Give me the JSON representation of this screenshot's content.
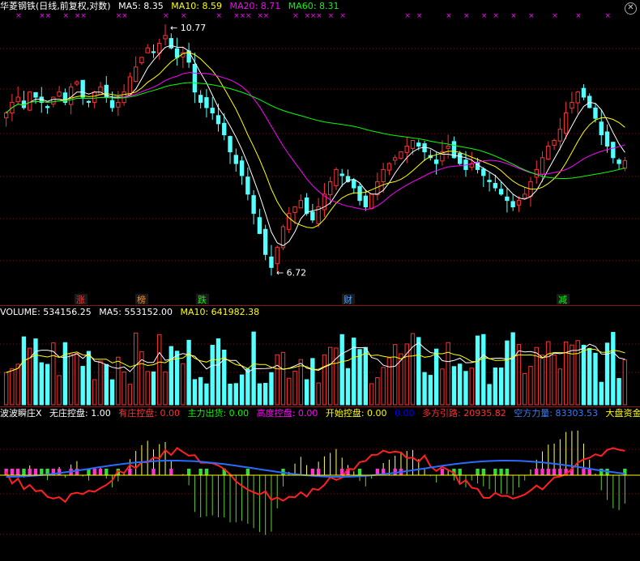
{
  "main": {
    "title": "华菱钢铁(日线,前复权,对数)",
    "ma5": "MA5: 8.35",
    "ma10": "MA10: 8.59",
    "ma20": "MA20: 8.71",
    "ma60": "MA60: 8.31",
    "high_label": "10.77",
    "low_label": "6.72",
    "event_markers": [
      "涨",
      "榜",
      "跌",
      "财",
      "减"
    ],
    "colors": {
      "up": "#ff3232",
      "down": "#54ffff",
      "ma5": "#ffffff",
      "ma10": "#ffff00",
      "ma20": "#ff00ff",
      "ma60": "#00ff00",
      "marker": "#ff00ff"
    }
  },
  "volume": {
    "volume": "VOLUME: 534156.25",
    "ma5": "MA5: 553152.00",
    "ma10": "MA10: 641982.38"
  },
  "indicator": {
    "name": "波波瞬庄X",
    "items": [
      {
        "text": "无庄控盘: 1.00",
        "color": "#ffffff"
      },
      {
        "text": "有庄控盘: 0.00",
        "color": "#ff3232"
      },
      {
        "text": "主力出货: 0.00",
        "color": "#00ff00"
      },
      {
        "text": "高度控盘: 0.00",
        "color": "#ff00ff"
      },
      {
        "text": "开始控盘: 0.00",
        "color": "#ffff00"
      },
      {
        "text": "0.00",
        "color": "#0000ff"
      },
      {
        "text": "多方引路: 20935.82",
        "color": "#ff3232"
      },
      {
        "text": "空方力量: 83303.53",
        "color": "#3a7bff"
      },
      {
        "text": "大盘资金",
        "color": "#ffff00"
      }
    ]
  },
  "chart_data": {
    "type": "candlestick",
    "closes": [
      9.2,
      9.4,
      9.5,
      9.3,
      9.6,
      9.5,
      9.4,
      9.3,
      9.5,
      9.6,
      9.4,
      9.7,
      9.8,
      9.5,
      9.4,
      9.6,
      9.7,
      9.5,
      9.3,
      9.4,
      9.6,
      9.9,
      10.1,
      10.3,
      10.5,
      10.4,
      10.6,
      10.77,
      10.5,
      10.3,
      10.4,
      10.2,
      9.6,
      9.4,
      9.3,
      9.2,
      9.0,
      8.8,
      8.5,
      8.3,
      8.1,
      7.8,
      7.5,
      7.2,
      6.9,
      6.72,
      7.0,
      7.3,
      7.5,
      7.6,
      7.7,
      7.5,
      7.4,
      7.6,
      7.8,
      8.0,
      8.2,
      8.1,
      8.0,
      7.9,
      7.7,
      7.6,
      7.8,
      8.0,
      8.2,
      8.3,
      8.4,
      8.5,
      8.6,
      8.7,
      8.6,
      8.5,
      8.4,
      8.3,
      8.5,
      8.6,
      8.4,
      8.3,
      8.2,
      8.3,
      8.2,
      8.1,
      8.0,
      7.9,
      7.8,
      7.7,
      7.6,
      7.7,
      7.8,
      8.0,
      8.2,
      8.4,
      8.6,
      8.7,
      8.9,
      9.2,
      9.4,
      9.6,
      9.5,
      9.3,
      9.1,
      8.8,
      8.6,
      8.4,
      8.3,
      8.35
    ],
    "ma_periods": [
      5,
      10,
      20,
      60
    ],
    "price_axis": "log"
  }
}
